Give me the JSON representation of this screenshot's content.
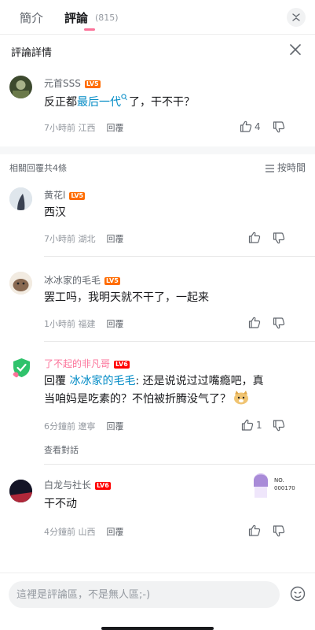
{
  "tabs": [
    {
      "label": "簡介"
    },
    {
      "label": "評論",
      "count": "(815)"
    }
  ],
  "detail": {
    "title": "評論詳情"
  },
  "main_comment": {
    "username": "元首SSS",
    "level": "LV5",
    "text_before": "反正都",
    "link_text": "最后一代",
    "text_after": "了，干不干？",
    "time_location": "7小時前 江西",
    "reply_label": "回覆",
    "likes": "4"
  },
  "replies_header": {
    "count_text": "相關回覆共4條",
    "sort_label": "按時間"
  },
  "replies": [
    {
      "username": "黄花l",
      "level": "LV5",
      "text": "西汉",
      "time_location": "7小時前 湖北",
      "reply_label": "回覆"
    },
    {
      "username": "冰冰家的毛毛",
      "level": "LV5",
      "text": "罢工吗，我明天就不干了，一起来",
      "time_location": "1小時前 福建",
      "reply_label": "回覆"
    },
    {
      "username": "了不起的非凡哥",
      "level": "LV6",
      "reply_prefix": "回覆 ",
      "mention": "冰冰家的毛毛",
      "text": ": 还是说说过过嘴瘾吧，真当咱妈是吃素的？不怕被折腾没气了？",
      "time_location": "6分鐘前 遼寧",
      "reply_label": "回覆",
      "likes": "1",
      "view_conversation": "查看對話"
    },
    {
      "username": "白龙与社长",
      "level": "LV6",
      "text": "干不动",
      "time_location": "4分鐘前 山西",
      "reply_label": "回覆",
      "badge": "NO.\n000170"
    }
  ],
  "input": {
    "placeholder": "這裡是評論區，不是無人區;-)"
  },
  "colors": {
    "accent_pink": "#fb7299",
    "link_blue": "#008ac5",
    "lv5": "#ff6c00",
    "lv6": "#ff0000"
  }
}
